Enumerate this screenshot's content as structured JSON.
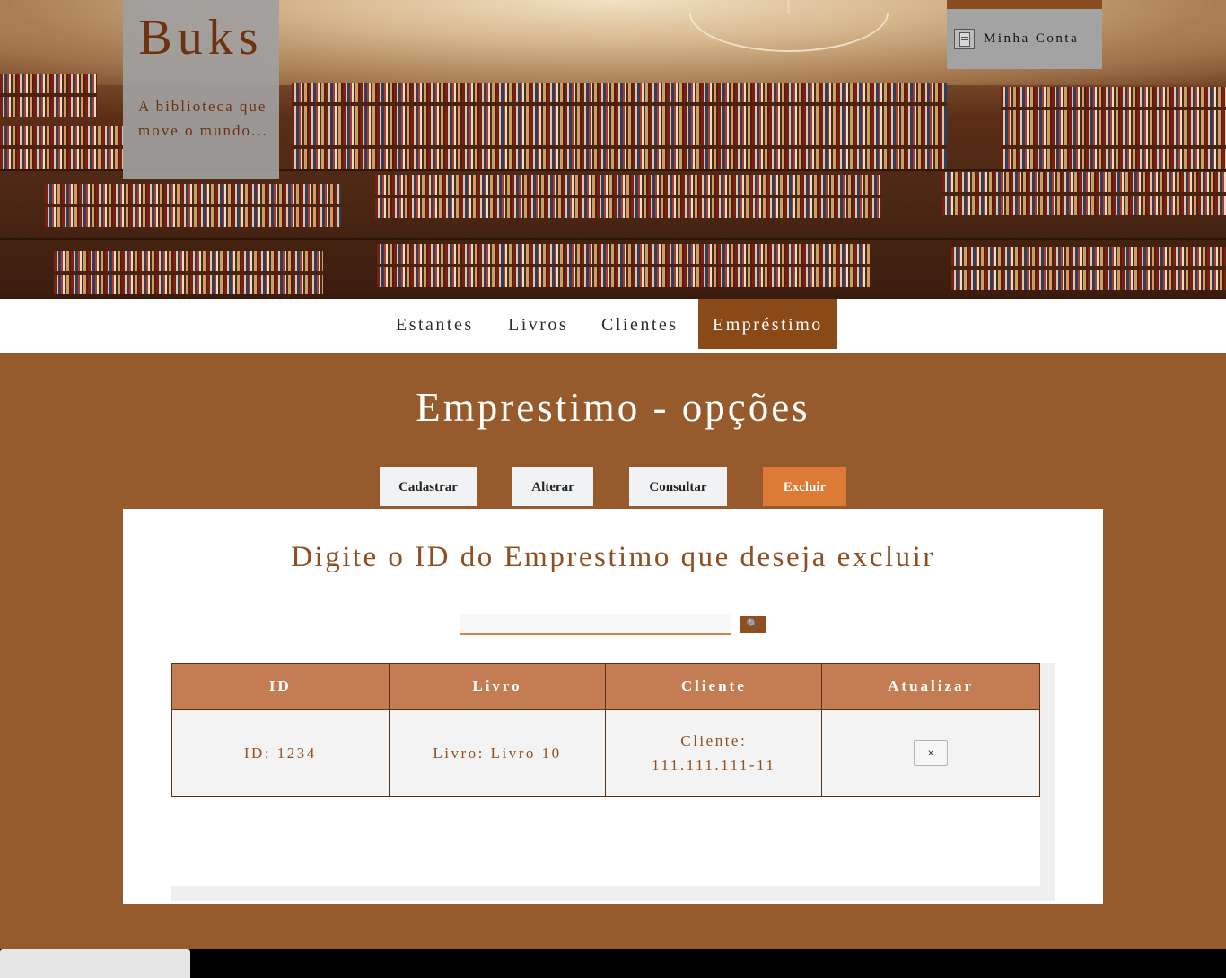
{
  "header": {
    "brand_title": "Buks",
    "brand_tagline": "A biblioteca que move o mundo...",
    "account_label": "Minha Conta",
    "account_icon": "account-doc-icon"
  },
  "nav": {
    "items": [
      {
        "label": "Estantes"
      },
      {
        "label": "Livros"
      },
      {
        "label": "Clientes"
      },
      {
        "label": "Empréstimo",
        "active": true
      }
    ]
  },
  "main": {
    "title": "Emprestimo - opções",
    "options": [
      {
        "label": "Cadastrar"
      },
      {
        "label": "Alterar"
      },
      {
        "label": "Consultar"
      },
      {
        "label": "Excluir",
        "active": true
      }
    ]
  },
  "panel": {
    "title": "Digite o ID do Emprestimo que deseja excluir",
    "search": {
      "value": "",
      "placeholder": "",
      "button_glyph": "🔍",
      "button_icon": "search-icon"
    },
    "table": {
      "headers": [
        "ID",
        "Livro",
        "Cliente",
        "Atualizar"
      ],
      "rows": [
        {
          "id": "ID: 1234",
          "livro": "Livro: Livro 10",
          "cliente": "Cliente: 111.111.111-11",
          "action": "×"
        }
      ]
    }
  },
  "colors": {
    "brand_brown": "#975a2c",
    "nav_active": "#8a4a18",
    "option_active": "#dd7a35",
    "table_header": "#c47d52",
    "text_brown": "#8e4f22"
  }
}
